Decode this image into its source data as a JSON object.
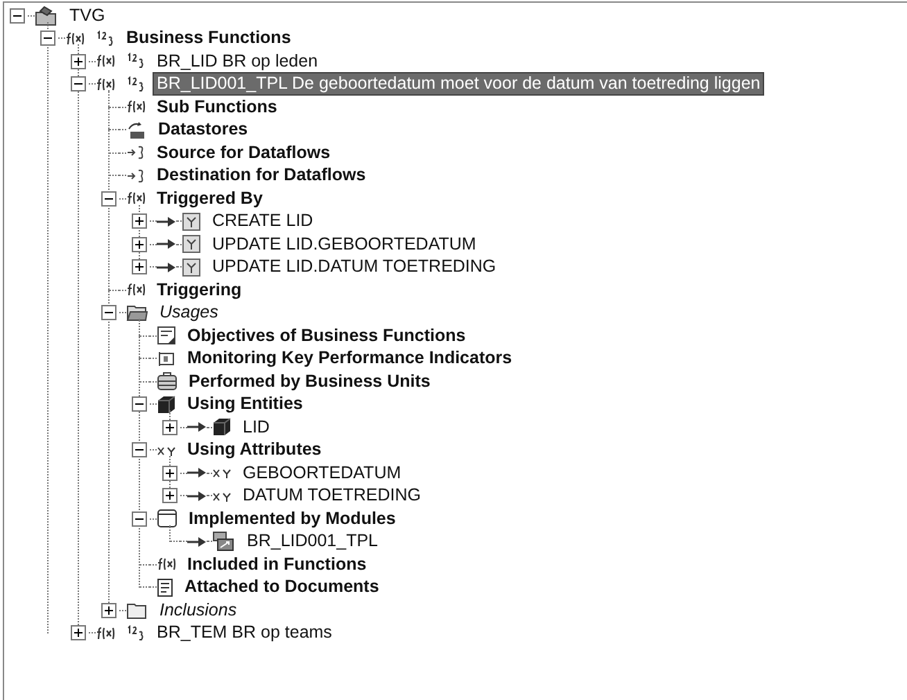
{
  "tree": [
    {
      "label": "TVG",
      "kind": "workspace",
      "expanded": true,
      "selected": false,
      "children": [
        {
          "label": "Business Functions",
          "kind": "rule-category",
          "expanded": true,
          "selected": false,
          "children": [
            {
              "label": "BR_LID BR op leden",
              "kind": "rule",
              "expanded": false,
              "selected": false
            },
            {
              "label": "BR_LID001_TPL De geboortedatum moet voor de datum van toetreding liggen",
              "kind": "rule",
              "expanded": true,
              "selected": true,
              "children": [
                {
                  "label": "Sub Functions",
                  "kind": "function-category",
                  "selected": false
                },
                {
                  "label": "Datastores",
                  "kind": "datastore-category",
                  "selected": false
                },
                {
                  "label": "Source for Dataflows",
                  "kind": "dataflow-category",
                  "selected": false
                },
                {
                  "label": "Destination for Dataflows",
                  "kind": "dataflow-category",
                  "selected": false
                },
                {
                  "label": "Triggered By",
                  "kind": "function-category",
                  "expanded": true,
                  "selected": false,
                  "children": [
                    {
                      "label": "CREATE LID",
                      "kind": "event",
                      "link": true,
                      "expanded": false,
                      "selected": false
                    },
                    {
                      "label": "UPDATE LID.GEBOORTEDATUM",
                      "kind": "event",
                      "link": true,
                      "expanded": false,
                      "selected": false
                    },
                    {
                      "label": "UPDATE LID.DATUM TOETREDING",
                      "kind": "event",
                      "link": true,
                      "expanded": false,
                      "selected": false
                    }
                  ]
                },
                {
                  "label": "Triggering",
                  "kind": "function-category",
                  "selected": false
                },
                {
                  "label": "Usages",
                  "kind": "open-folder",
                  "expanded": true,
                  "selected": false,
                  "children": [
                    {
                      "label": "Objectives of Business Functions",
                      "kind": "objective-category",
                      "selected": false
                    },
                    {
                      "label": "Monitoring Key Performance Indicators",
                      "kind": "kpi-category",
                      "selected": false
                    },
                    {
                      "label": "Performed by Business Units",
                      "kind": "unit-category",
                      "selected": false
                    },
                    {
                      "label": "Using Entities",
                      "kind": "entity-category",
                      "expanded": true,
                      "selected": false,
                      "children": [
                        {
                          "label": "LID",
                          "kind": "entity",
                          "link": true,
                          "expanded": false,
                          "selected": false
                        }
                      ]
                    },
                    {
                      "label": "Using Attributes",
                      "kind": "attribute-category",
                      "expanded": true,
                      "selected": false,
                      "children": [
                        {
                          "label": "GEBOORTEDATUM",
                          "kind": "attribute",
                          "link": true,
                          "expanded": false,
                          "selected": false
                        },
                        {
                          "label": "DATUM TOETREDING",
                          "kind": "attribute",
                          "link": true,
                          "expanded": false,
                          "selected": false
                        }
                      ]
                    },
                    {
                      "label": "Implemented by Modules",
                      "kind": "module-category",
                      "expanded": true,
                      "selected": false,
                      "children": [
                        {
                          "label": "BR_LID001_TPL",
                          "kind": "module",
                          "link": true,
                          "selected": false
                        }
                      ]
                    },
                    {
                      "label": "Included in Functions",
                      "kind": "function-category",
                      "selected": false
                    },
                    {
                      "label": "Attached to Documents",
                      "kind": "document-category",
                      "selected": false
                    }
                  ]
                },
                {
                  "label": "Inclusions",
                  "kind": "folder",
                  "expanded": false,
                  "selected": false
                }
              ]
            },
            {
              "label": "BR_TEM BR op teams",
              "kind": "rule",
              "expanded": false,
              "selected": false
            }
          ]
        }
      ]
    }
  ]
}
